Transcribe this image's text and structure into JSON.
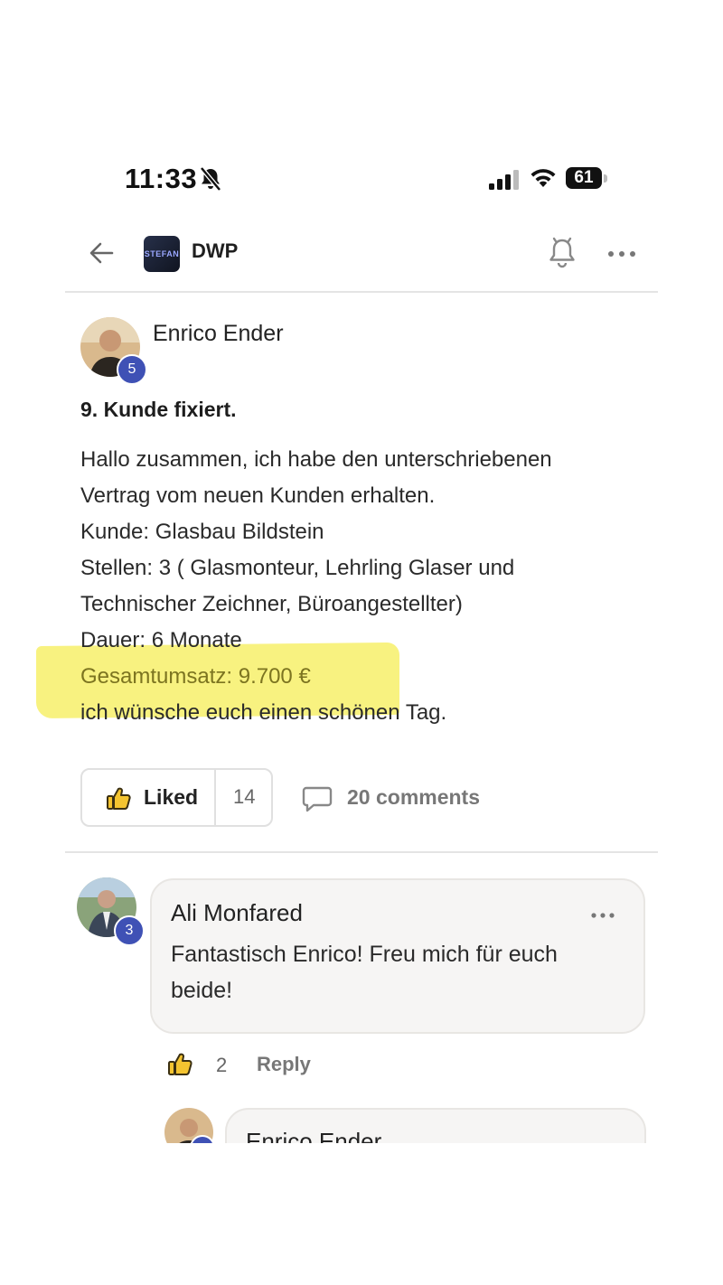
{
  "status_bar": {
    "time": "11:33",
    "battery": "61"
  },
  "header": {
    "group_name": "DWP",
    "logo_text": "STEFAN"
  },
  "post": {
    "author": "Enrico Ender",
    "author_level": "5",
    "title": "9. Kunde fixiert.",
    "body_lines": [
      "Hallo zusammen, ich habe den unterschriebenen",
      "Vertrag vom neuen Kunden erhalten.",
      "Kunde: Glasbau Bildstein",
      "Stellen: 3 ( Glasmonteur, Lehrling Glaser und",
      "Technischer Zeichner, Büroangestellter)",
      "Dauer: 6 Monate",
      "Gesamtumsatz: 9.700 €",
      "ich wünsche euch einen schönen Tag."
    ],
    "like_label": "Liked",
    "like_count": "14",
    "comments_label": "20 comments"
  },
  "comment": {
    "author": "Ali Monfared",
    "author_level": "3",
    "text": "Fantastisch Enrico! Freu mich für euch beide!",
    "like_count": "2",
    "reply_label": "Reply"
  },
  "reply": {
    "author": "Enrico Ender"
  },
  "colors": {
    "badge": "#3f51b5",
    "highlight": "#f7f06a",
    "like_icon": "#f4c430"
  }
}
